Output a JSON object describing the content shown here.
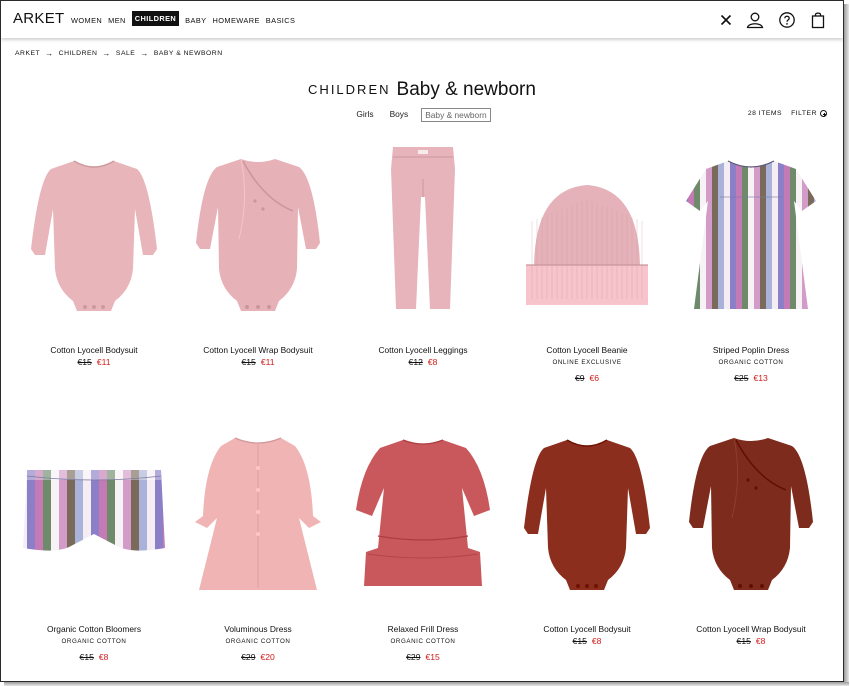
{
  "header": {
    "logo": "ARKET",
    "nav": [
      {
        "label": "WOMEN",
        "active": false
      },
      {
        "label": "MEN",
        "active": false
      },
      {
        "label": "CHILDREN",
        "active": true
      },
      {
        "label": "BABY",
        "active": false
      },
      {
        "label": "HOMEWARE",
        "active": false
      },
      {
        "label": "BASICS",
        "active": false
      }
    ],
    "icons": [
      "close-icon",
      "account-icon",
      "help-icon",
      "bag-icon"
    ]
  },
  "breadcrumb": [
    "ARKET",
    "CHILDREN",
    "SALE",
    "BABY & NEWBORN"
  ],
  "title": {
    "section": "CHILDREN",
    "subsection": "Baby & newborn"
  },
  "subnav": [
    {
      "label": "Girls",
      "active": false
    },
    {
      "label": "Boys",
      "active": false
    },
    {
      "label": "Baby & newborn",
      "active": true
    }
  ],
  "toolbar": {
    "count": "28 ITEMS",
    "filter": "FILTER"
  },
  "products": [
    {
      "name": "Cotton Lyocell Bodysuit",
      "tag": "",
      "old_price": "€15",
      "new_price": "€11",
      "color": "#e8b5bb",
      "shape": "bodysuit"
    },
    {
      "name": "Cotton Lyocell Wrap Bodysuit",
      "tag": "",
      "old_price": "€15",
      "new_price": "€11",
      "color": "#e6b2b8",
      "shape": "wrap"
    },
    {
      "name": "Cotton Lyocell Leggings",
      "tag": "",
      "old_price": "€12",
      "new_price": "€8",
      "color": "#e6b4ba",
      "shape": "leggings"
    },
    {
      "name": "Cotton Lyocell Beanie",
      "tag": "ONLINE EXCLUSIVE",
      "old_price": "€9",
      "new_price": "€6",
      "color": "#e4b2b8",
      "shape": "beanie"
    },
    {
      "name": "Striped Poplin Dress",
      "tag": "ORGANIC COTTON",
      "old_price": "€25",
      "new_price": "€13",
      "color": "#9c83c4",
      "shape": "dress-striped"
    },
    {
      "name": "Organic Cotton Bloomers",
      "tag": "ORGANIC COTTON",
      "old_price": "€15",
      "new_price": "€8",
      "color": "#a08ac6",
      "shape": "bloomers"
    },
    {
      "name": "Voluminous Dress",
      "tag": "ORGANIC COTTON",
      "old_price": "€29",
      "new_price": "€20",
      "color": "#f0b4b4",
      "shape": "dress-volume"
    },
    {
      "name": "Relaxed Frill Dress",
      "tag": "ORGANIC COTTON",
      "old_price": "€29",
      "new_price": "€15",
      "color": "#c9585c",
      "shape": "dress-frill"
    },
    {
      "name": "Cotton Lyocell Bodysuit",
      "tag": "",
      "old_price": "€15",
      "new_price": "€8",
      "color": "#8b2e1e",
      "shape": "bodysuit"
    },
    {
      "name": "Cotton Lyocell Wrap Bodysuit",
      "tag": "",
      "old_price": "€15",
      "new_price": "€8",
      "color": "#7d2b1d",
      "shape": "wrap"
    }
  ]
}
